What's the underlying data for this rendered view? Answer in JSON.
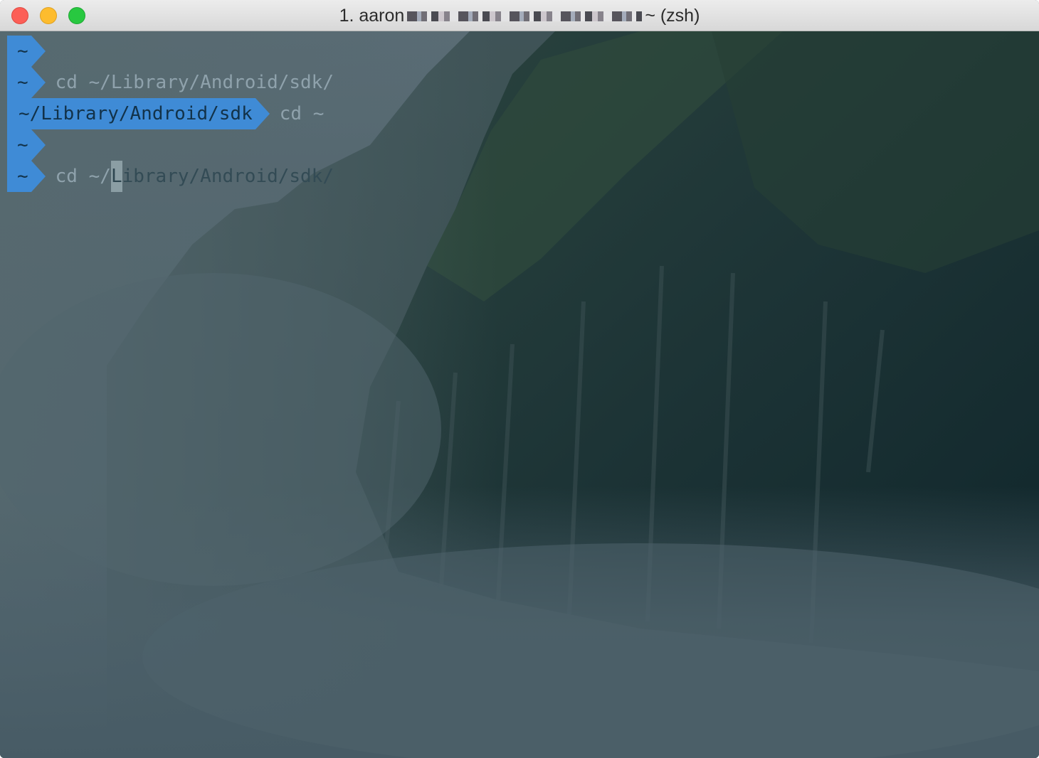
{
  "window": {
    "title_prefix": "1. aaron",
    "title_suffix": "~ (zsh)"
  },
  "colors": {
    "prompt_segment": "#3f8bd6",
    "prompt_text": "#123249",
    "command_text": "#8fa2ac",
    "background_fog": "#4b5f69"
  },
  "terminal": {
    "lines": [
      {
        "prompt": "~",
        "command": ""
      },
      {
        "prompt": "~",
        "command": "cd ~/Library/Android/sdk/"
      },
      {
        "prompt": "~/Library/Android/sdk",
        "command": "cd ~"
      },
      {
        "prompt": "~",
        "command": ""
      },
      {
        "prompt": "~",
        "command_before_cursor": "cd ~/",
        "cursor_char": "L",
        "command_after_cursor": "ibrary/Android/sdk/"
      }
    ]
  }
}
